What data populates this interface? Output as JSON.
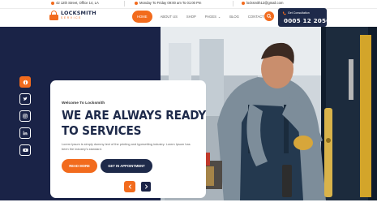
{
  "topbar": {
    "address": "42 12th Street, Office 14, LA",
    "hours": "Monday To Friday 09:00 am To 01:00 Pm",
    "email": "locksmith12@gmail.com"
  },
  "logo": {
    "name": "LOCKSMITH",
    "tagline": "SERVICE"
  },
  "nav": {
    "items": [
      "HOME",
      "ABOUT US",
      "SHOP",
      "PAGES",
      "BLOG",
      "CONTACT US"
    ],
    "active": "HOME"
  },
  "consult": {
    "label": "Get Consultation",
    "phone": "0005 12 2050"
  },
  "hero": {
    "welcome": "Welcome To Locksmith",
    "headline_line1": "WE ARE ALWAYS READY",
    "headline_line2": "TO SERVICES",
    "description": "Lorem Ipsum is simply dummy text of the printing and typesetting industry. Lorem Ipsum has been the industry's standard.",
    "read_more": "READ MORE",
    "appointment": "GET IN APPOINTMENT"
  },
  "socials": [
    "info-icon",
    "twitter-icon",
    "instagram-icon",
    "linkedin-icon",
    "youtube-icon"
  ],
  "colors": {
    "accent": "#f26b1d",
    "navy": "#1e2a4a",
    "hero_bg": "#1a2347"
  }
}
